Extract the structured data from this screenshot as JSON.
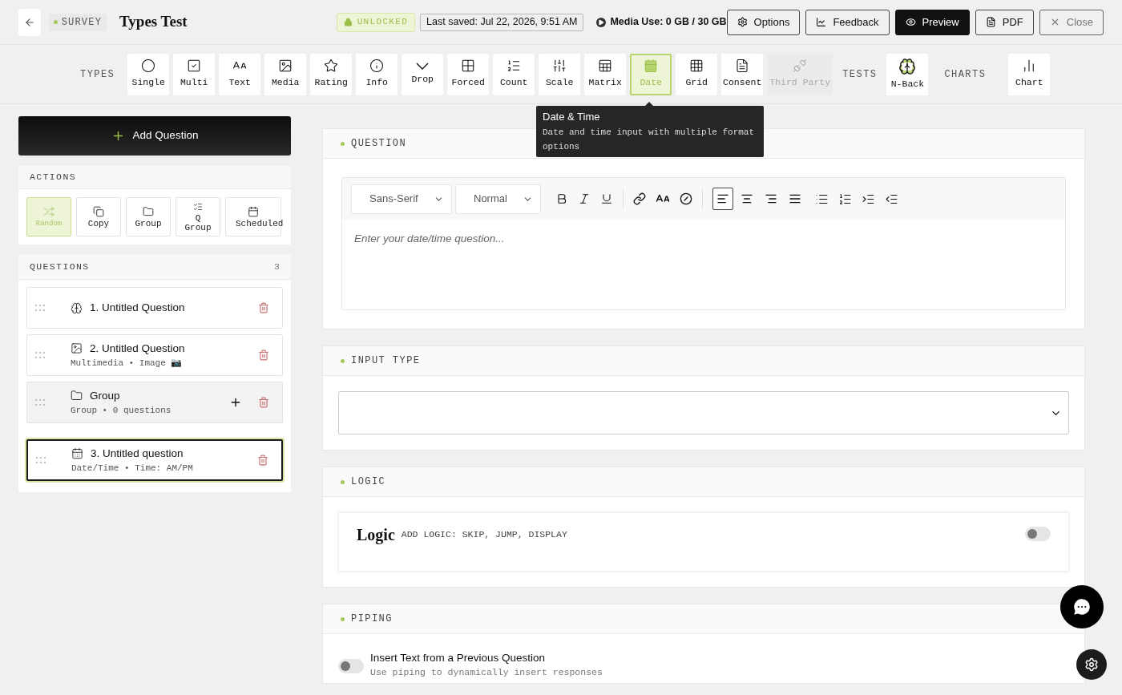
{
  "header": {
    "badge": "SURVEY",
    "title": "Types Test",
    "lock_status": "UNLOCKED",
    "last_saved": "Last saved: Jul 22, 2026, 9:51 AM",
    "media_use": "Media Use: 0 GB / 30 GB",
    "buttons": [
      {
        "label": "Options",
        "kind": "outline"
      },
      {
        "label": "Feedback",
        "kind": "outline"
      },
      {
        "label": "Preview",
        "kind": "primary"
      },
      {
        "label": "PDF",
        "kind": "outline"
      },
      {
        "label": "Close",
        "kind": "muted"
      }
    ]
  },
  "toolbar": {
    "types_label": "TYPES",
    "types": [
      {
        "label": "Single",
        "selected": false,
        "disabled": false
      },
      {
        "label": "Multi",
        "selected": false,
        "disabled": false
      },
      {
        "label": "Text",
        "selected": false,
        "disabled": false
      },
      {
        "label": "Media",
        "selected": false,
        "disabled": false
      },
      {
        "label": "Rating",
        "selected": false,
        "disabled": false
      },
      {
        "label": "Info",
        "selected": false,
        "disabled": false
      },
      {
        "label": "Drop",
        "selected": false,
        "disabled": false
      },
      {
        "label": "Forced",
        "selected": false,
        "disabled": false
      },
      {
        "label": "Count",
        "selected": false,
        "disabled": false
      },
      {
        "label": "Scale",
        "selected": false,
        "disabled": false
      },
      {
        "label": "Matrix",
        "selected": false,
        "disabled": false
      },
      {
        "label": "Date",
        "selected": true,
        "disabled": false
      },
      {
        "label": "Grid",
        "selected": false,
        "disabled": false
      },
      {
        "label": "Consent",
        "selected": false,
        "disabled": false
      },
      {
        "label": "Third Party",
        "selected": false,
        "disabled": true
      }
    ],
    "tests_label": "TESTS",
    "tests": [
      {
        "label": "N-Back"
      }
    ],
    "charts_label": "CHARTS",
    "charts": [
      {
        "label": "Chart"
      }
    ],
    "tooltip": {
      "title": "Date & Time",
      "text": "Date and time input with multiple format options"
    }
  },
  "sidebar": {
    "add_button": "Add Question",
    "actions_heading": "ACTIONS",
    "actions": [
      {
        "label": "Random",
        "selected": true
      },
      {
        "label": "Copy",
        "selected": false
      },
      {
        "label": "Group",
        "selected": false
      },
      {
        "label": "Q Group",
        "selected": false
      },
      {
        "label": "Scheduled",
        "selected": false
      }
    ],
    "questions_heading": "QUESTIONS",
    "questions_count": "3",
    "questions": [
      {
        "kind": "question",
        "title": "1. Untitled Question",
        "selected": false
      },
      {
        "kind": "question",
        "title": "2. Untitled Question",
        "subtitle": "Multimedia • Image 📷",
        "selected": false
      },
      {
        "kind": "group",
        "title": "Group",
        "subtitle": "Group • 0 questions",
        "selected": false
      },
      {
        "kind": "question",
        "title": "3. Untitled question",
        "subtitle": "Date/Time • Time: AM/PM",
        "selected": true
      }
    ]
  },
  "question_panel": {
    "heading": "QUESTION",
    "font_select": "Sans-Serif",
    "size_select": "Normal",
    "alignments": [
      {
        "selected": true
      },
      {
        "selected": false
      },
      {
        "selected": false
      },
      {
        "selected": false
      }
    ],
    "placeholder": "Enter your date/time question..."
  },
  "input_type_panel": {
    "heading": "INPUT TYPE"
  },
  "logic_panel": {
    "heading": "LOGIC",
    "title": "Logic",
    "description": "ADD LOGIC: SKIP, JUMP, DISPLAY",
    "on": false
  },
  "piping_panel": {
    "heading": "PIPING",
    "title": "Insert Text from a Previous Question",
    "description": "Use piping to dynamically insert responses",
    "on": false
  }
}
